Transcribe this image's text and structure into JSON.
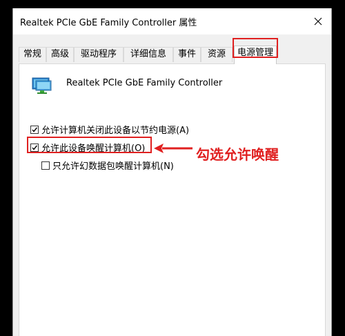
{
  "window": {
    "title": "Realtek PCIe GbE Family Controller 属性"
  },
  "tabs": [
    {
      "label": "常规",
      "active": false
    },
    {
      "label": "高级",
      "active": false
    },
    {
      "label": "驱动程序",
      "active": false
    },
    {
      "label": "详细信息",
      "active": false
    },
    {
      "label": "事件",
      "active": false
    },
    {
      "label": "资源",
      "active": false
    },
    {
      "label": "电源管理",
      "active": true
    }
  ],
  "device": {
    "name": "Realtek PCIe GbE Family Controller",
    "icon": "network-adapter-icon"
  },
  "options": [
    {
      "label": "允许计算机关闭此设备以节约电源(A)",
      "checked": true,
      "enabled": true
    },
    {
      "label": "允许此设备唤醒计算机(O)",
      "checked": true,
      "enabled": true
    },
    {
      "label": "只允许幻数据包唤醒计算机(N)",
      "checked": false,
      "enabled": true
    }
  ],
  "annotation": {
    "text": "勾选允许唤醒"
  },
  "colors": {
    "highlight": "#e02020",
    "window_bg": "#f0f0f0",
    "panel_bg": "#ffffff"
  }
}
